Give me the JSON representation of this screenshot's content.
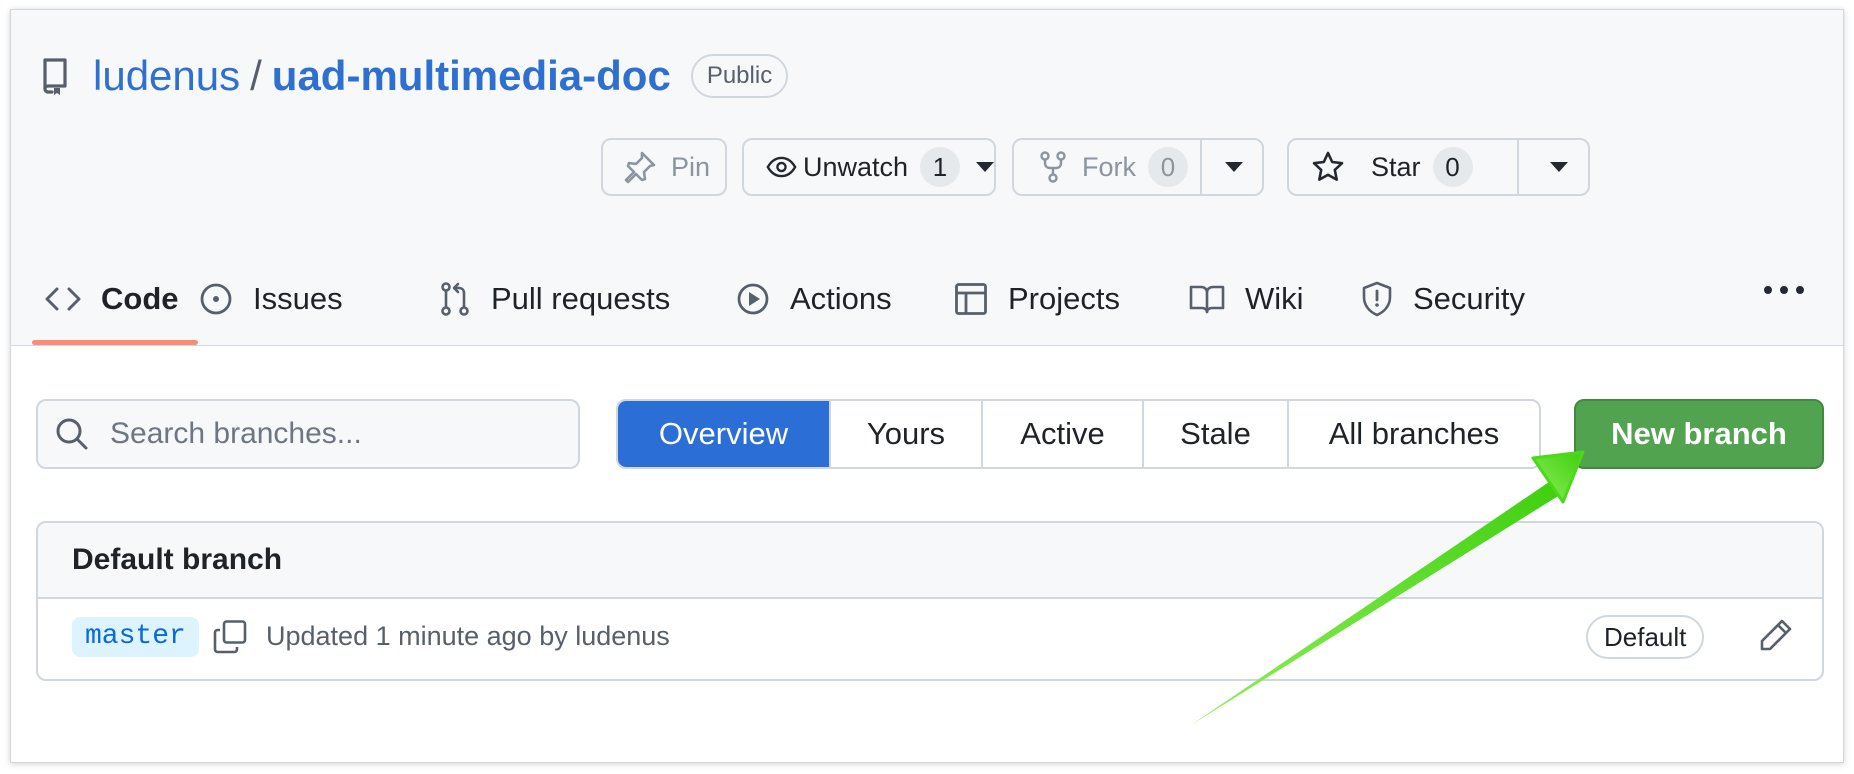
{
  "repo": {
    "owner": "ludenus",
    "separator": "/",
    "name": "uad-multimedia-doc",
    "visibility": "Public"
  },
  "actions": {
    "pin_label": "Pin",
    "unwatch_label": "Unwatch",
    "watch_count": "1",
    "fork_label": "Fork",
    "fork_count": "0",
    "star_label": "Star",
    "star_count": "0"
  },
  "tabs": [
    {
      "label": "Code",
      "icon": "code-icon",
      "active": true
    },
    {
      "label": "Issues",
      "icon": "issue-icon"
    },
    {
      "label": "Pull requests",
      "icon": "pull-request-icon"
    },
    {
      "label": "Actions",
      "icon": "play-icon"
    },
    {
      "label": "Projects",
      "icon": "table-icon"
    },
    {
      "label": "Wiki",
      "icon": "book-icon"
    },
    {
      "label": "Security",
      "icon": "shield-icon"
    }
  ],
  "branches": {
    "search_placeholder": "Search branches...",
    "filters": [
      "Overview",
      "Yours",
      "Active",
      "Stale",
      "All branches"
    ],
    "selected_filter": "Overview",
    "new_branch_label": "New branch",
    "default_section_title": "Default branch",
    "default_branch": {
      "name": "master",
      "updated_text": "Updated 1 minute ago by ludenus",
      "badge": "Default"
    }
  },
  "colors": {
    "link": "#2f6fd0",
    "selected_filter_bg": "#2b6fd6",
    "new_branch_bg": "#52a350",
    "tab_underline": "#fd8c73",
    "annotation_arrow": "#55e01a"
  }
}
